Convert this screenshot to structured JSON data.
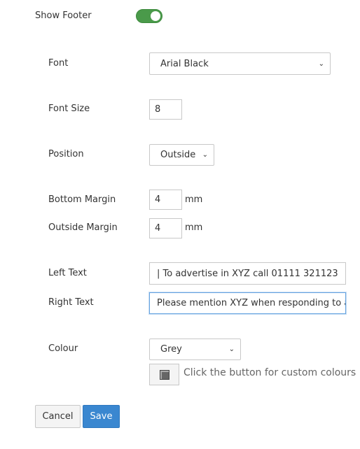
{
  "show_footer": {
    "label": "Show Footer",
    "enabled": true
  },
  "font": {
    "label": "Font",
    "value": "Arial Black"
  },
  "font_size": {
    "label": "Font Size",
    "value": "8"
  },
  "position": {
    "label": "Position",
    "value": "Outside"
  },
  "bottom_margin": {
    "label": "Bottom Margin",
    "value": "4",
    "unit": "mm"
  },
  "outside_margin": {
    "label": "Outside Margin",
    "value": "4",
    "unit": "mm"
  },
  "left_text": {
    "label": "Left Text",
    "value": "| To advertise in XYZ call 01111 321123"
  },
  "right_text": {
    "label": "Right Text",
    "value": "Please mention XYZ when responding to advertisements"
  },
  "colour": {
    "label": "Colour",
    "value": "Grey",
    "hint": "Click the button for custom colours"
  },
  "actions": {
    "cancel": "Cancel",
    "save": "Save"
  },
  "colors": {
    "toggle_on": "#4a9a4a",
    "save_button": "#3a87d0",
    "focus_border": "#66a3e0"
  }
}
